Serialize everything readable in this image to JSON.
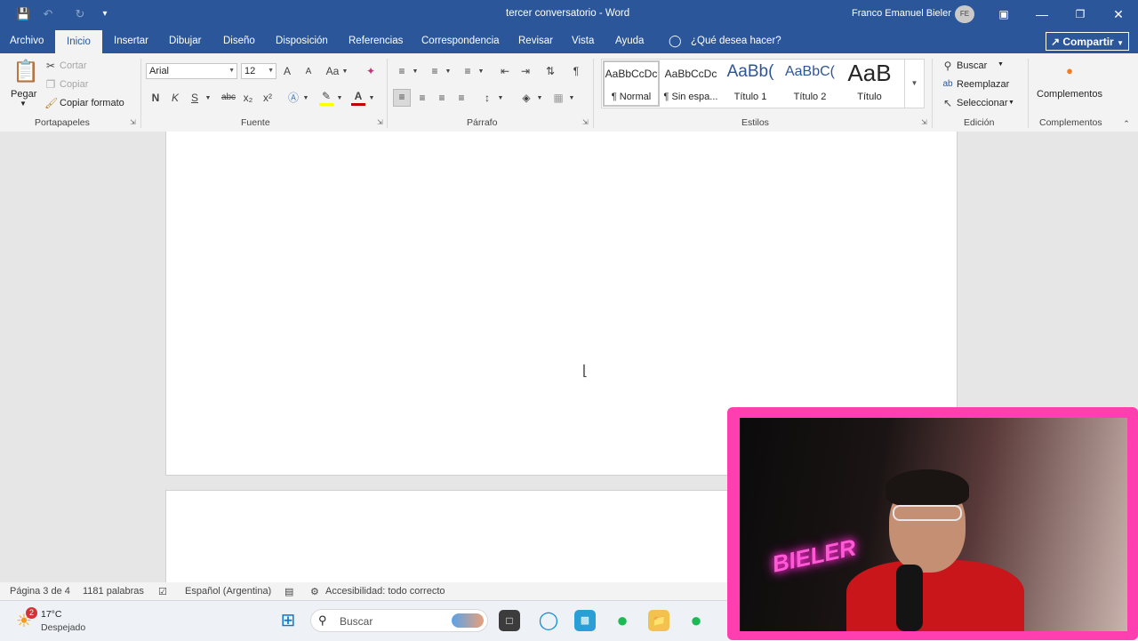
{
  "window": {
    "doc_title": "tercer conversatorio",
    "separator": " - ",
    "app_name": "Word",
    "user_name": "Franco Emanuel Bieler",
    "user_initials": "FE"
  },
  "tabs": [
    "Archivo",
    "Inicio",
    "Insertar",
    "Dibujar",
    "Diseño",
    "Disposición",
    "Referencias",
    "Correspondencia",
    "Revisar",
    "Vista",
    "Ayuda"
  ],
  "tell_me": "¿Qué desea hacer?",
  "share_label": "Compartir",
  "clipboard": {
    "paste": "Pegar",
    "cut": "Cortar",
    "copy": "Copiar",
    "format_painter": "Copiar formato",
    "group": "Portapapeles"
  },
  "font": {
    "name": "Arial",
    "size": "12",
    "grow": "A",
    "shrink": "A",
    "case": "Aa",
    "bold": "N",
    "italic": "K",
    "underline": "S",
    "strike": "abc",
    "subscript": "x₂",
    "superscript": "x²",
    "group": "Fuente"
  },
  "paragraph": {
    "group": "Párrafo",
    "show_marks": "¶"
  },
  "styles": {
    "items": [
      {
        "preview": "AaBbCcDc",
        "name": "¶ Normal"
      },
      {
        "preview": "AaBbCcDc",
        "name": "¶ Sin espa..."
      },
      {
        "preview": "AaBb(",
        "name": "Título 1"
      },
      {
        "preview": "AaBbC(",
        "name": "Título 2"
      },
      {
        "preview": "AaB",
        "name": "Título"
      }
    ],
    "group": "Estilos"
  },
  "editing": {
    "find": "Buscar",
    "replace": "Reemplazar",
    "select": "Seleccionar",
    "group": "Edición"
  },
  "addins": {
    "label": "Complementos",
    "group": "Complementos"
  },
  "status": {
    "page": "Página 3 de 4",
    "words": "1181 palabras",
    "language": "Español (Argentina)",
    "accessibility": "Accesibilidad: todo correcto"
  },
  "taskbar": {
    "weather_badge": "2",
    "temperature": "17°C",
    "condition": "Despejado",
    "search_placeholder": "Buscar"
  },
  "webcam": {
    "neon_sign": "BIELER"
  },
  "colors": {
    "word_blue": "#2b579a",
    "ribbon_bg": "#f3f3f3",
    "webcam_frame": "#ff3fb0",
    "font_color_red": "#c00000",
    "highlight_yellow": "#ffff00"
  }
}
